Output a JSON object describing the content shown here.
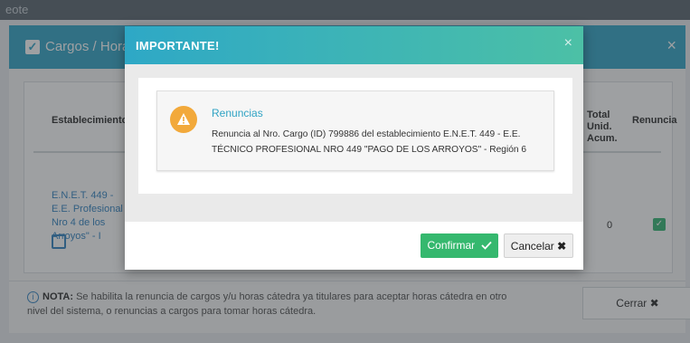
{
  "background": {
    "top_strip_text": "eote",
    "modal_title": "Cargos / Horas",
    "table_headers": {
      "establecimiento": "Establecimiento",
      "total": "Total Unid. Acum.",
      "renuncia": "Renuncia"
    },
    "row": {
      "establecimiento_link": "E.N.E.T. 449 - E.E. Profesional Nro 4 de los Arroyos\" - I",
      "total": "0"
    },
    "note": {
      "label": "NOTA:",
      "text": "Se habilita la renuncia de cargos y/u horas cátedra ya titulares para aceptar horas cátedra en otro nivel del sistema, o renuncias a cargos para tomar horas cátedra."
    },
    "close_button": "Cerrar ✖"
  },
  "modal": {
    "title": "IMPORTANTE!",
    "close_glyph": "×",
    "alert": {
      "title": "Renuncias",
      "message": "Renuncia al Nro. Cargo (ID) 799886 del establecimiento E.N.E.T. 449 - E.E. TÉCNICO PROFESIONAL NRO 449 \"PAGO DE LOS ARROYOS\" - Región 6"
    },
    "confirm_label": "Confirmar",
    "cancel_label": "Cancelar"
  },
  "colors": {
    "header_gradient_start": "#2ea8c6",
    "header_gradient_end": "#4cc0a6",
    "warning": "#f2a93b",
    "confirm": "#35b86e",
    "accent_text": "#2fa3c4"
  },
  "icons": [
    "warning-icon",
    "checkmark-icon",
    "x-mark-icon",
    "info-icon",
    "edit-icon"
  ]
}
